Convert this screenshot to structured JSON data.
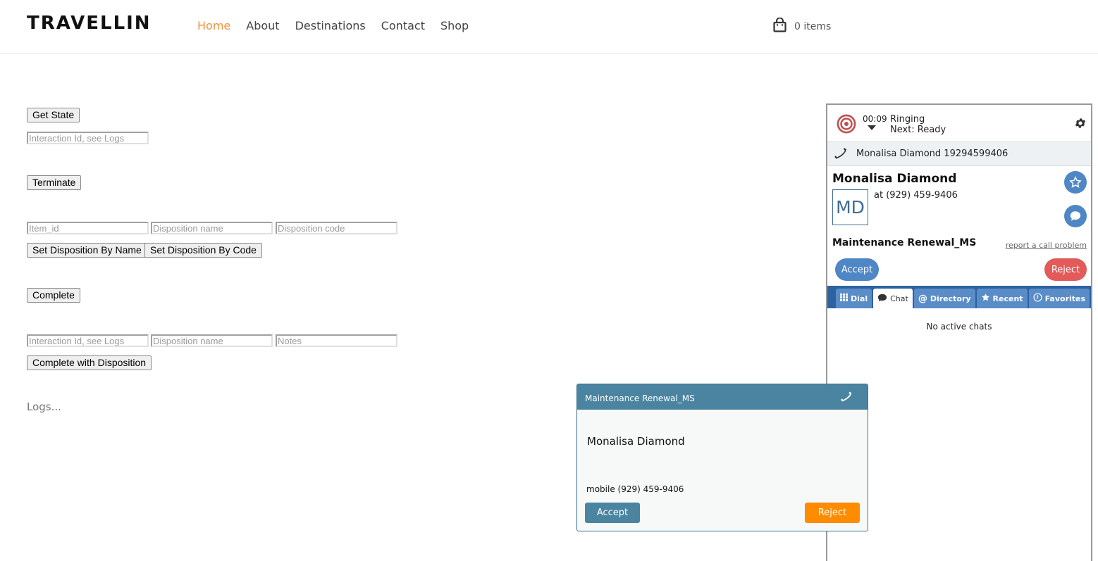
{
  "header": {
    "brand": "TRAVELLIN",
    "nav": [
      "Home",
      "About",
      "Destinations",
      "Contact",
      "Shop"
    ],
    "cart_text": "0 items"
  },
  "form": {
    "get_state_label": "Get State",
    "interaction_id_placeholder": "Interaction Id, see Logs",
    "terminate_label": "Terminate",
    "item_id_placeholder": "Item_id",
    "disposition_name_placeholder": "Disposition name",
    "disposition_code_placeholder": "Disposition code",
    "set_by_name_label": "Set Disposition By Name",
    "set_by_code_label": "Set Disposition By Code",
    "complete_label": "Complete",
    "interaction_id2_placeholder": "Interaction Id, see Logs",
    "disposition_name2_placeholder": "Disposition name",
    "notes_placeholder": "Notes",
    "complete_with_disposition_label": "Complete with Disposition",
    "logs_label": "Logs..."
  },
  "softphone": {
    "timer": "00:09",
    "state": "Ringing",
    "next_state": "Next: Ready",
    "call_line": "Monalisa Diamond 19294599406",
    "contact_name": "Monalisa Diamond",
    "avatar_initials": "MD",
    "contact_phone": "at (929) 459-9406",
    "campaign": "Maintenance Renewal_MS",
    "report_link": "report a call problem",
    "accept_label": "Accept",
    "reject_label": "Reject",
    "tabs": [
      "Dial",
      "Chat",
      "Directory",
      "Recent",
      "Favorites"
    ],
    "active_tab": "Chat",
    "empty_chats": "No active chats"
  },
  "popup": {
    "title": "Maintenance Renewal_MS",
    "name": "Monalisa Diamond",
    "number": "mobile (929) 459-9406",
    "accept_label": "Accept",
    "reject_label": "Reject"
  },
  "colors": {
    "nav_active": "#f0923a",
    "softphone_blue": "#4f86c6",
    "softphone_reject": "#e35a5a",
    "tab_bar": "#2d62a1",
    "popup_header": "#4a84a0",
    "popup_reject": "#ff8c00"
  },
  "icons": [
    "shopping-bag-icon",
    "target-icon",
    "gear-icon",
    "phone-icon",
    "star-icon",
    "chat-bubble-icon",
    "dialpad-icon",
    "at-icon",
    "clock-icon"
  ]
}
